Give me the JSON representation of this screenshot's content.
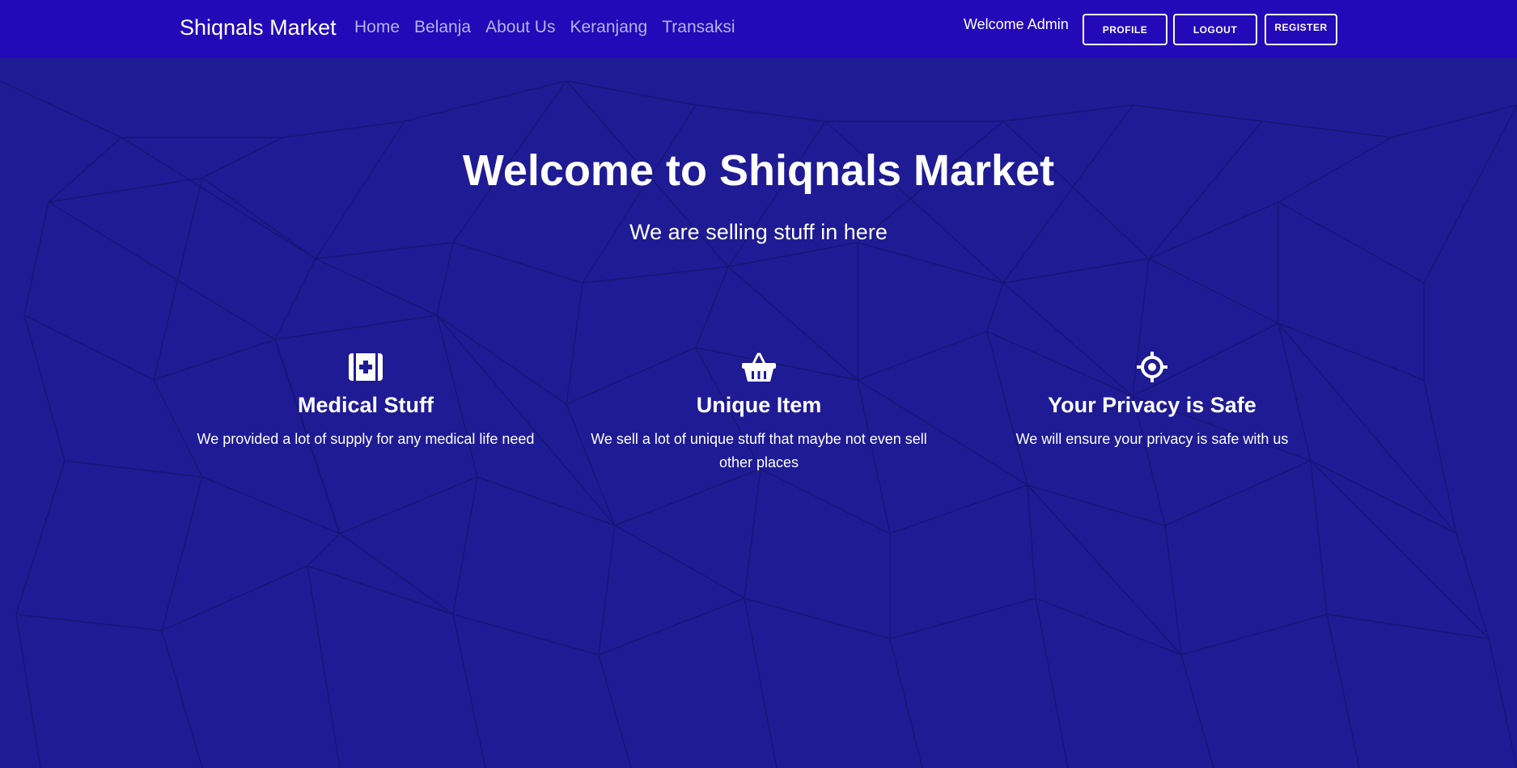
{
  "navbar": {
    "brand": "Shiqnals Market",
    "links": [
      "Home",
      "Belanja",
      "About Us",
      "Keranjang",
      "Transaksi"
    ],
    "welcome": "Welcome Admin",
    "profile_label": "PROFILE",
    "logout_label": "LOGOUT",
    "register_label": "REGISTER"
  },
  "hero": {
    "title": "Welcome to Shiqnals Market",
    "subtitle": "We are selling stuff in here"
  },
  "features": [
    {
      "icon": "medical-kit-icon",
      "title": "Medical Stuff",
      "text": "We provided a lot of supply for any medical life need"
    },
    {
      "icon": "basket-icon",
      "title": "Unique Item",
      "text": "We sell a lot of unique stuff that maybe not even sell other places"
    },
    {
      "icon": "crosshairs-icon",
      "title": "Your Privacy is Safe",
      "text": "We will ensure your privacy is safe with us"
    }
  ],
  "colors": {
    "navbar": "#2409b8",
    "background": "#1e1b94",
    "nav_link": "#b5b3ea",
    "text": "#ffffff"
  }
}
